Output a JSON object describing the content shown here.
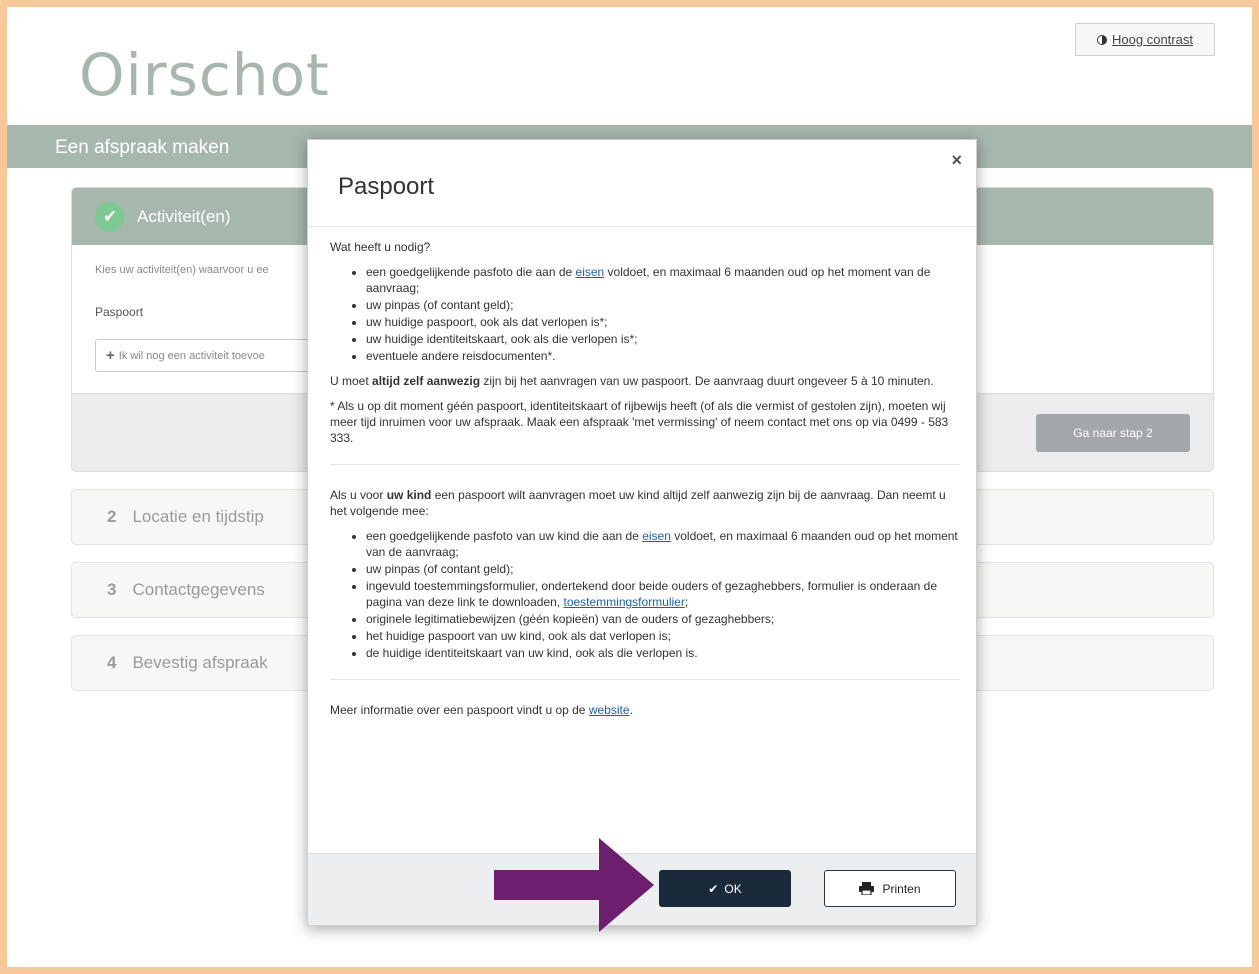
{
  "header": {
    "logo": "Oirschot",
    "contrast_label": "Hoog contrast",
    "page_title": "Een afspraak maken"
  },
  "step1": {
    "title": "Activiteit(en)",
    "intro": "Kies uw activiteit(en) waarvoor u ee",
    "activity": "Paspoort",
    "add_label": "Ik wil nog een activiteit toevoe",
    "next_button": "Ga naar stap 2"
  },
  "steps": [
    {
      "num": "2",
      "label": "Locatie en tijdstip"
    },
    {
      "num": "3",
      "label": "Contactgegevens"
    },
    {
      "num": "4",
      "label": "Bevestig afspraak"
    }
  ],
  "modal": {
    "title": "Paspoort",
    "close": "×",
    "intro": "Wat heeft u nodig?",
    "list1": {
      "item1_pre": "een goedgelijkende pasfoto die aan de ",
      "item1_link": "eisen",
      "item1_post": " voldoet, en maximaal 6 maanden oud op het moment van de aanvraag;",
      "item2": "uw pinpas (of contant geld);",
      "item3": "uw huidige paspoort, ook als dat verlopen is*;",
      "item4": "uw huidige identiteitskaart, ook als die verlopen is*;",
      "item5": "eventuele andere reisdocumenten*."
    },
    "para_presence_pre": "U moet ",
    "para_presence_bold": "altijd zelf aanwezig",
    "para_presence_post": " zijn bij het aanvragen van uw paspoort. De aanvraag duurt ongeveer 5 à 10 minuten.",
    "para_note": "* Als u op dit moment géén paspoort, identiteitskaart of rijbewijs heeft (of als die vermist of gestolen zijn), moeten wij meer tijd inruimen voor uw afspraak. Maak een afspraak 'met vermissing' of neem contact met ons op via 0499 - 583 333.",
    "para_child_pre": "Als u voor ",
    "para_child_bold": "uw kind",
    "para_child_post": " een paspoort wilt aanvragen moet uw kind altijd zelf aanwezig zijn bij de aanvraag. Dan neemt u het volgende mee:",
    "list2": {
      "item1_pre": "een goedgelijkende pasfoto van uw kind die aan de ",
      "item1_link": "eisen",
      "item1_post": " voldoet, en maximaal 6 maanden oud op het moment van de aanvraag;",
      "item2": "uw pinpas (of contant geld);",
      "item3_pre": "ingevuld toestemmingsformulier, ondertekend door beide ouders of gezaghebbers, formulier is onderaan de pagina van deze link te downloaden, ",
      "item3_link": "toestemmingsformulier",
      "item3_post": ";",
      "item4": "originele legitimatiebewijzen (géén kopieën) van de ouders of gezaghebbers;",
      "item5": "het huidige paspoort van uw kind, ook als dat verlopen is;",
      "item6": "de huidige identiteitskaart van uw kind, ook als die verlopen is."
    },
    "more_info_pre": "Meer informatie over een paspoort vindt u op de ",
    "more_info_link": "website",
    "more_info_post": ".",
    "ok_label": "OK",
    "print_label": "Printen"
  },
  "colors": {
    "frame": "#f7c99a",
    "brand": "#a7b7ae",
    "ok_button": "#1b2a3a",
    "arrow": "#6b1f6e",
    "link": "#1f5fb3"
  }
}
